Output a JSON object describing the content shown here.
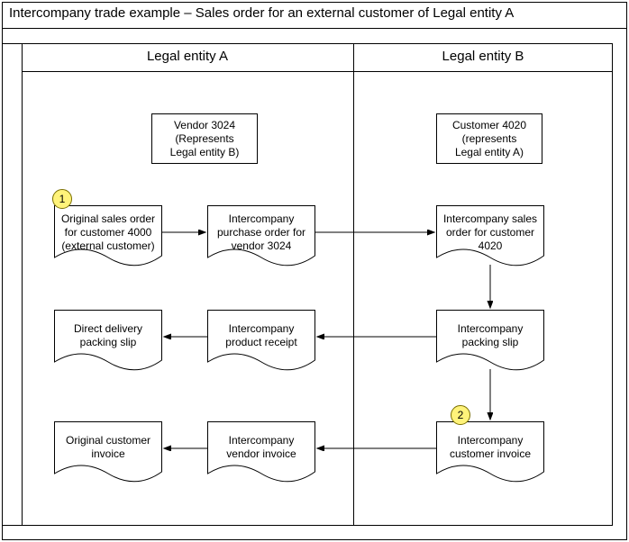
{
  "title": "Intercompany trade example – Sales order for an external customer of Legal entity A",
  "columns": {
    "a": "Legal entity A",
    "b": "Legal entity B"
  },
  "boxes": {
    "vendor": "Vendor 3024\n(Represents\nLegal entity B)",
    "customer": "Customer 4020\n(represents\nLegal entity A)"
  },
  "docs": {
    "a1": "Original sales order for customer 4000 (external customer)",
    "a2": "Intercompany purchase order for vendor 3024",
    "b2": "Intercompany sales order for customer 4020",
    "a3": "Direct delivery packing slip",
    "a4": "Intercompany product receipt",
    "b4": "Intercompany packing slip",
    "a5": "Original customer invoice",
    "a6": "Intercompany vendor invoice",
    "b6": "Intercompany customer invoice"
  },
  "badges": {
    "one": "1",
    "two": "2"
  }
}
